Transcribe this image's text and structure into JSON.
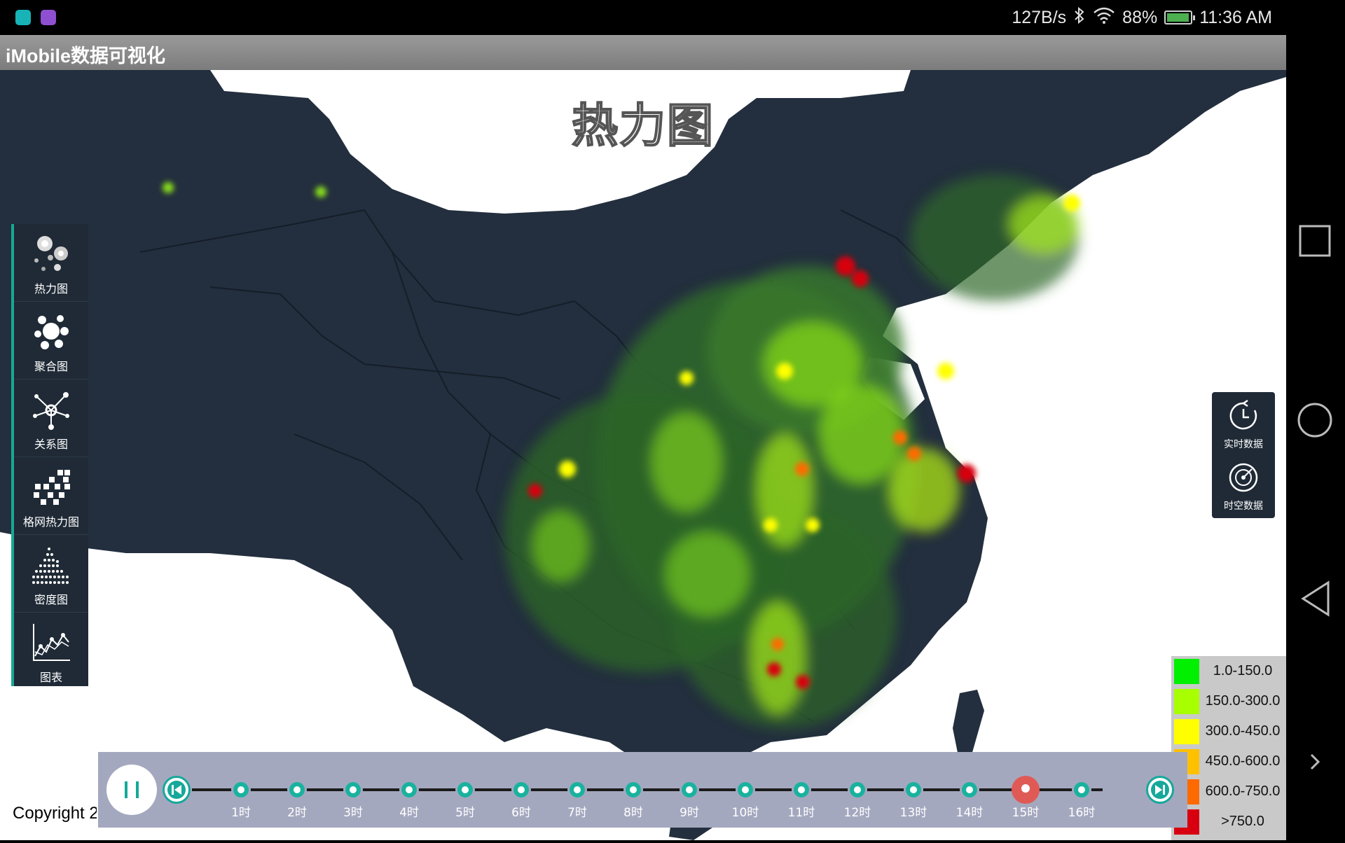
{
  "status_bar": {
    "speed": "127B/s",
    "battery": "88%",
    "time": "11:36 AM",
    "colors": {
      "app_icon_1": "#17b3b6",
      "app_icon_2": "#8f4fd1"
    }
  },
  "app": {
    "title": "iMobile数据可视化"
  },
  "map": {
    "title": "热力图"
  },
  "toolbar": {
    "items": [
      {
        "label": "热力图",
        "icon": "heatmap-icon"
      },
      {
        "label": "聚合图",
        "icon": "cluster-icon"
      },
      {
        "label": "关系图",
        "icon": "relation-graph-icon"
      },
      {
        "label": "格网热力图",
        "icon": "grid-heatmap-icon"
      },
      {
        "label": "密度图",
        "icon": "density-icon"
      },
      {
        "label": "图表",
        "icon": "chart-icon"
      }
    ]
  },
  "right_panel": {
    "realtime_label": "实时数据",
    "spatiotemporal_label": "时空数据"
  },
  "legend": {
    "items": [
      {
        "label": "1.0-150.0",
        "color": "#00f000"
      },
      {
        "label": "150.0-300.0",
        "color": "#a8ff00"
      },
      {
        "label": "300.0-450.0",
        "color": "#ffff00"
      },
      {
        "label": "450.0-600.0",
        "color": "#ffc000"
      },
      {
        "label": "600.0-750.0",
        "color": "#ff6a00"
      },
      {
        "label": ">750.0",
        "color": "#d80010"
      }
    ]
  },
  "timeline": {
    "ticks": [
      "1时",
      "2时",
      "3时",
      "4时",
      "5时",
      "6时",
      "7时",
      "8时",
      "9时",
      "10时",
      "11时",
      "12时",
      "13时",
      "14时",
      "15时",
      "16时"
    ],
    "current_index": 14,
    "colors": {
      "accent": "#16a89a",
      "current": "#e05a55"
    }
  },
  "copyright": "Copyright 2"
}
